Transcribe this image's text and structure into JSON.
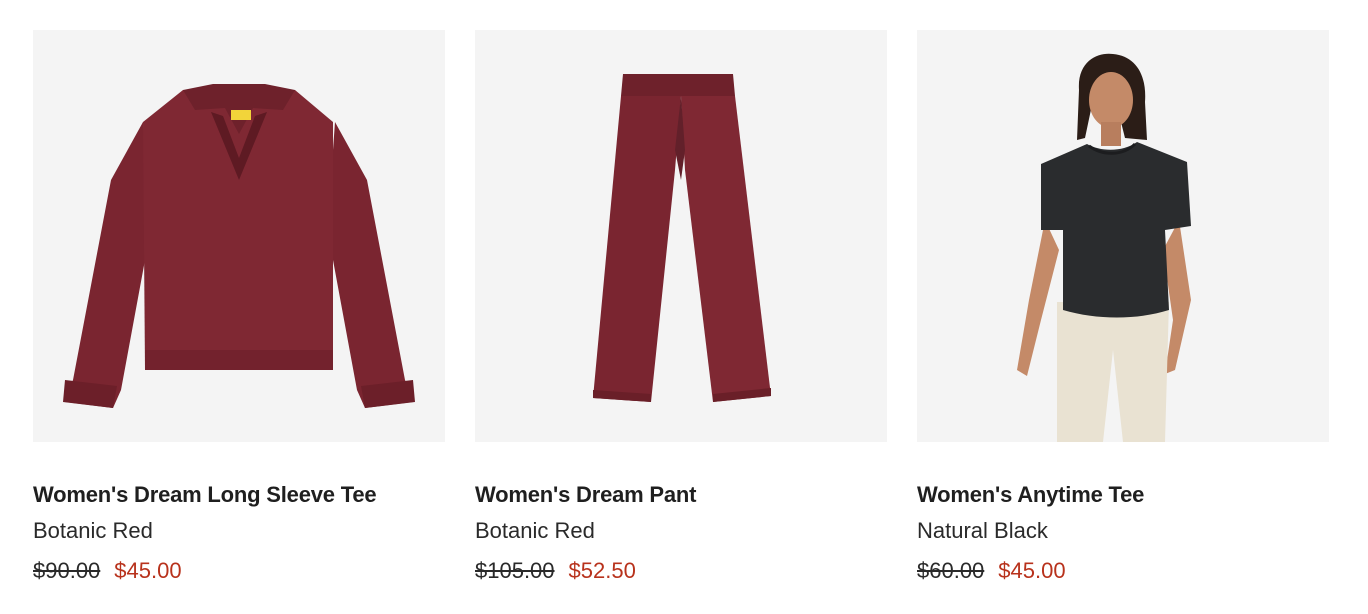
{
  "products": [
    {
      "name": "Women's Dream Long Sleeve Tee",
      "color": "Botanic Red",
      "original_price": "$90.00",
      "sale_price": "$45.00",
      "image": "long-sleeve-polo-red"
    },
    {
      "name": "Women's Dream Pant",
      "color": "Botanic Red",
      "original_price": "$105.00",
      "sale_price": "$52.50",
      "image": "wide-leg-pant-red"
    },
    {
      "name": "Women's Anytime Tee",
      "color": "Natural Black",
      "original_price": "$60.00",
      "sale_price": "$45.00",
      "image": "model-black-tee"
    }
  ],
  "colors": {
    "image_background": "#f4f4f4",
    "garment_red": "#7a2530",
    "sale_price": "#b8321c",
    "text": "#1f1f1f"
  }
}
